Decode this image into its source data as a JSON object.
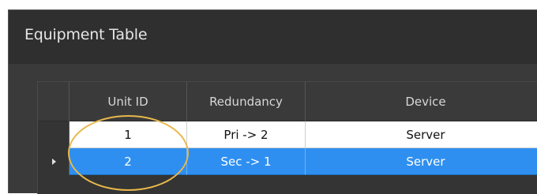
{
  "panel": {
    "title": "Equipment Table"
  },
  "table": {
    "columns": [
      "Unit ID",
      "Redundancy",
      "Device"
    ],
    "rows": [
      {
        "unit_id": "1",
        "redundancy": "Pri -> 2",
        "device": "Server",
        "selected": false
      },
      {
        "unit_id": "2",
        "redundancy": "Sec -> 1",
        "device": "Server",
        "selected": true
      }
    ]
  },
  "colors": {
    "selection": "#2e8ff0",
    "highlight_ring": "#e8b84a",
    "panel_bg": "#3a3a3a"
  },
  "icons": {
    "current_row_indicator": "triangle-right-icon"
  }
}
